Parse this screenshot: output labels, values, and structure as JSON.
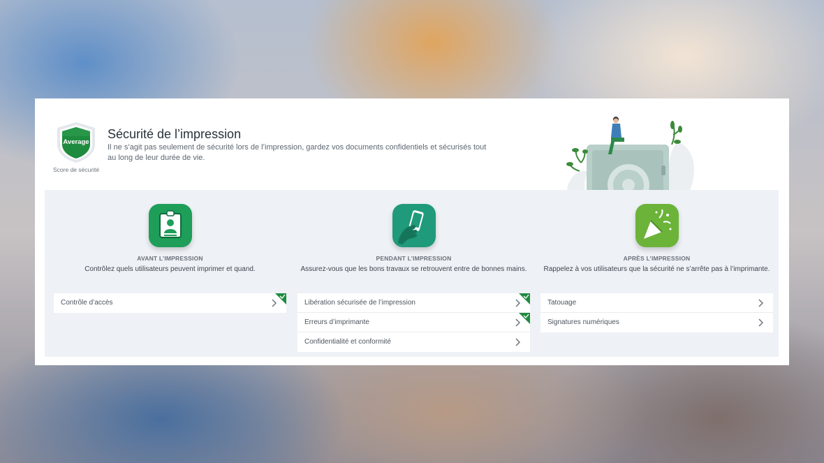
{
  "badge": {
    "level": "Average",
    "caption": "Score de sécurité",
    "color": "#1f8b3f"
  },
  "header": {
    "title": "Sécurité de l’impression",
    "subtitle": "Il ne s’agit pas seulement de sécurité lors de l’impression, gardez vos documents confidentiels et sécurisés tout au long de leur durée de vie."
  },
  "columns": [
    {
      "icon": "id-badge-icon",
      "color": "#1e9e59",
      "title": "AVANT L’IMPRESSION",
      "description": "Contrôlez quels utilisateurs peuvent imprimer et quand.",
      "items": [
        {
          "label": "Contrôle d’accès",
          "checked": true
        }
      ]
    },
    {
      "icon": "phone-in-hand-icon",
      "color": "#1f9a7a",
      "title": "PENDANT L’IMPRESSION",
      "description": "Assurez-vous que les bons travaux se retrouvent entre de bonnes mains.",
      "items": [
        {
          "label": "Libération sécurisée de l’impression",
          "checked": true
        },
        {
          "label": "Erreurs d’imprimante",
          "checked": true
        },
        {
          "label": "Confidentialité et conformité",
          "checked": false
        }
      ]
    },
    {
      "icon": "party-popper-icon",
      "color": "#6cb33a",
      "title": "APRÈS L’IMPRESSION",
      "description": "Rappelez à vos utilisateurs que la sécurité ne s’arrête pas à l’imprimante.",
      "items": [
        {
          "label": "Tatouage",
          "checked": false
        },
        {
          "label": "Signatures numériques",
          "checked": false
        }
      ]
    }
  ],
  "colors": {
    "check_green": "#1f8b3f",
    "panel_bg": "#eef1f5"
  }
}
